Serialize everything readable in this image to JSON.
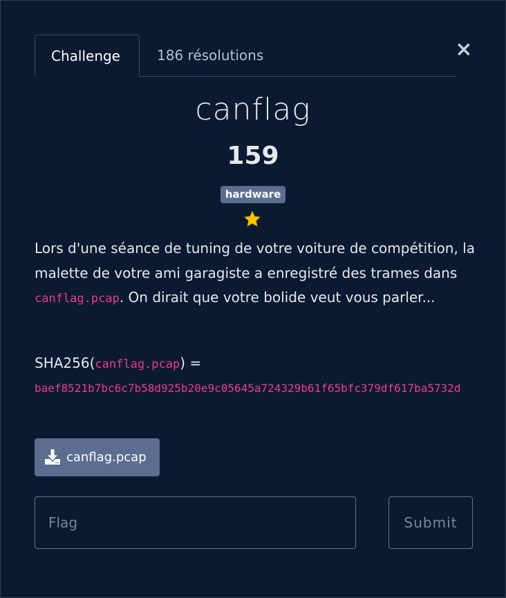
{
  "tabs": [
    {
      "label": "Challenge",
      "active": true
    },
    {
      "label": "186 résolutions",
      "active": false
    }
  ],
  "close_icon": "×",
  "challenge": {
    "name": "canflag",
    "points": "159",
    "category": "hardware",
    "star_icon": "star-icon"
  },
  "description": {
    "part1": "Lors d'une séance de tuning de votre voiture de compétition, la malette de votre ami garagiste a enregistré des trames dans ",
    "file_code": "canflag.pcap",
    "part2": ". On dirait que votre bolide veut vous parler..."
  },
  "sha": {
    "prefix": "SHA256(",
    "file_code": "canflag.pcap",
    "suffix": ") =",
    "hash": "baef8521b7bc6c7b58d925b20e9c05645a724329b61f65bfc379df617ba5732d"
  },
  "file_button": {
    "label": "canflag.pcap",
    "icon": "download-icon"
  },
  "flag_input": {
    "placeholder": "Flag",
    "value": ""
  },
  "submit_label": "Submit",
  "colors": {
    "background": "#0b1a30",
    "badge": "#5b6e90",
    "code": "#e63f8c",
    "star": "#f5c400"
  }
}
